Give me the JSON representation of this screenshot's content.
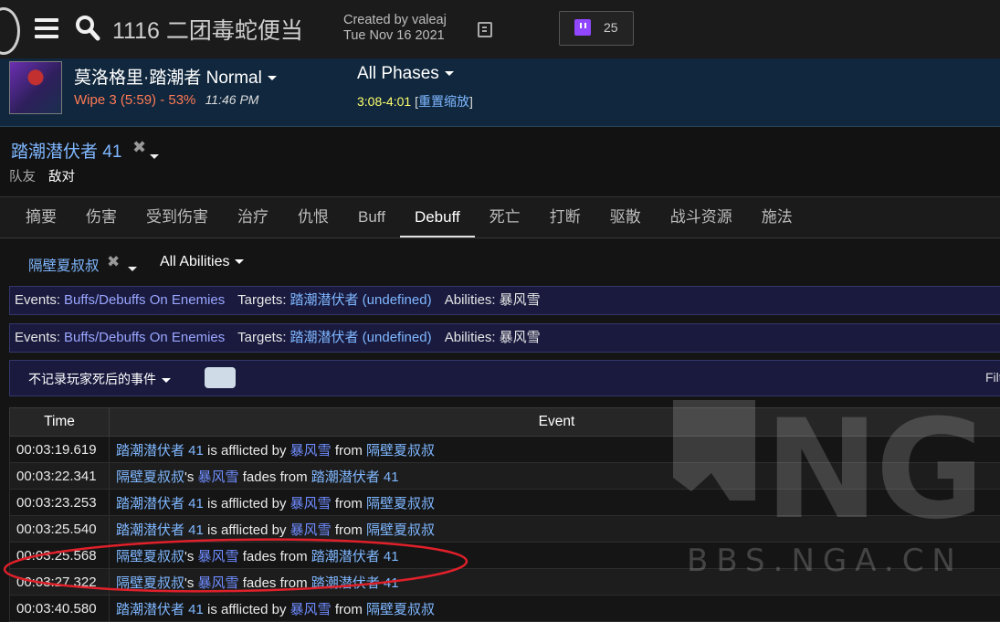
{
  "topbar": {
    "report_title": "1116 二团毒蛇便当",
    "created_by": "Created by valeaj",
    "created_date": "Tue Nov 16 2021",
    "twitch_count": "25"
  },
  "fight": {
    "boss_name": "莫洛格里·踏潮者 Normal",
    "wipe": "Wipe 3 (5:59) - 53%",
    "time": "11:46 PM",
    "phases": "All Phases",
    "phase_range": "3:08-4:01",
    "reset_zoom": "重置缩放"
  },
  "actor": {
    "name": "踏潮潜伏者 41",
    "remove_glyph": "✖",
    "tab_friendly": "队友",
    "tab_enemy": "敌对"
  },
  "tabs": [
    "摘要",
    "伤害",
    "受到伤害",
    "治疗",
    "仇恨",
    "Buff",
    "Debuff",
    "死亡",
    "打断",
    "驱散",
    "战斗资源",
    "施法"
  ],
  "active_tab": "Debuff",
  "filter": {
    "source": "隔壁夏叔叔",
    "remove_glyph": "✖",
    "abilities": "All Abilities"
  },
  "query": {
    "events_label": "Events:",
    "events_value": "Buffs/Debuffs On Enemies",
    "targets_label": "Targets:",
    "targets_value": "踏潮潜伏者 (undefined)",
    "abilities_label": "Abilities:",
    "abilities_value": "暴风雪"
  },
  "options": {
    "death_filter": "不记录玩家死后的事件",
    "filter_label": "Filt"
  },
  "table": {
    "headers": [
      "Time",
      "Event"
    ],
    "rows": [
      {
        "time": "00:03:19.619",
        "parts": [
          [
            "link",
            "踏潮潜伏者 41"
          ],
          [
            "text",
            " is afflicted by "
          ],
          [
            "abil",
            "暴风雪"
          ],
          [
            "text",
            " from "
          ],
          [
            "link",
            "隔壁夏叔叔"
          ]
        ]
      },
      {
        "time": "00:03:22.341",
        "parts": [
          [
            "link",
            "隔壁夏叔叔"
          ],
          [
            "text",
            "'s "
          ],
          [
            "abil",
            "暴风雪"
          ],
          [
            "text",
            " fades from "
          ],
          [
            "link",
            "踏潮潜伏者 41"
          ]
        ]
      },
      {
        "time": "00:03:23.253",
        "parts": [
          [
            "link",
            "踏潮潜伏者 41"
          ],
          [
            "text",
            " is afflicted by "
          ],
          [
            "abil",
            "暴风雪"
          ],
          [
            "text",
            " from "
          ],
          [
            "link",
            "隔壁夏叔叔"
          ]
        ]
      },
      {
        "time": "00:03:25.540",
        "parts": [
          [
            "link",
            "踏潮潜伏者 41"
          ],
          [
            "text",
            " is afflicted by "
          ],
          [
            "abil",
            "暴风雪"
          ],
          [
            "text",
            " from "
          ],
          [
            "link",
            "隔壁夏叔叔"
          ]
        ]
      },
      {
        "time": "00:03:25.568",
        "parts": [
          [
            "link",
            "隔壁夏叔叔"
          ],
          [
            "text",
            "'s "
          ],
          [
            "abil",
            "暴风雪"
          ],
          [
            "text",
            " fades from "
          ],
          [
            "link",
            "踏潮潜伏者 41"
          ]
        ]
      },
      {
        "time": "00:03:27.322",
        "parts": [
          [
            "link",
            "隔壁夏叔叔"
          ],
          [
            "text",
            "'s "
          ],
          [
            "abil",
            "暴风雪"
          ],
          [
            "text",
            " fades from "
          ],
          [
            "link",
            "踏潮潜伏者 41"
          ]
        ]
      },
      {
        "time": "00:03:40.580",
        "parts": [
          [
            "link",
            "踏潮潜伏者 41"
          ],
          [
            "text",
            " is afflicted by "
          ],
          [
            "abil",
            "暴风雪"
          ],
          [
            "text",
            " from "
          ],
          [
            "link",
            "隔壁夏叔叔"
          ]
        ]
      }
    ]
  },
  "watermark": {
    "logo_text": "NGA",
    "site": "BBS.NGA.CN"
  },
  "colors": {
    "link": "#7fb7ff",
    "ability": "#6f8cff",
    "wipe": "#ff7a55",
    "phase_range": "#ffff6e",
    "annotation": "#e0202a"
  }
}
